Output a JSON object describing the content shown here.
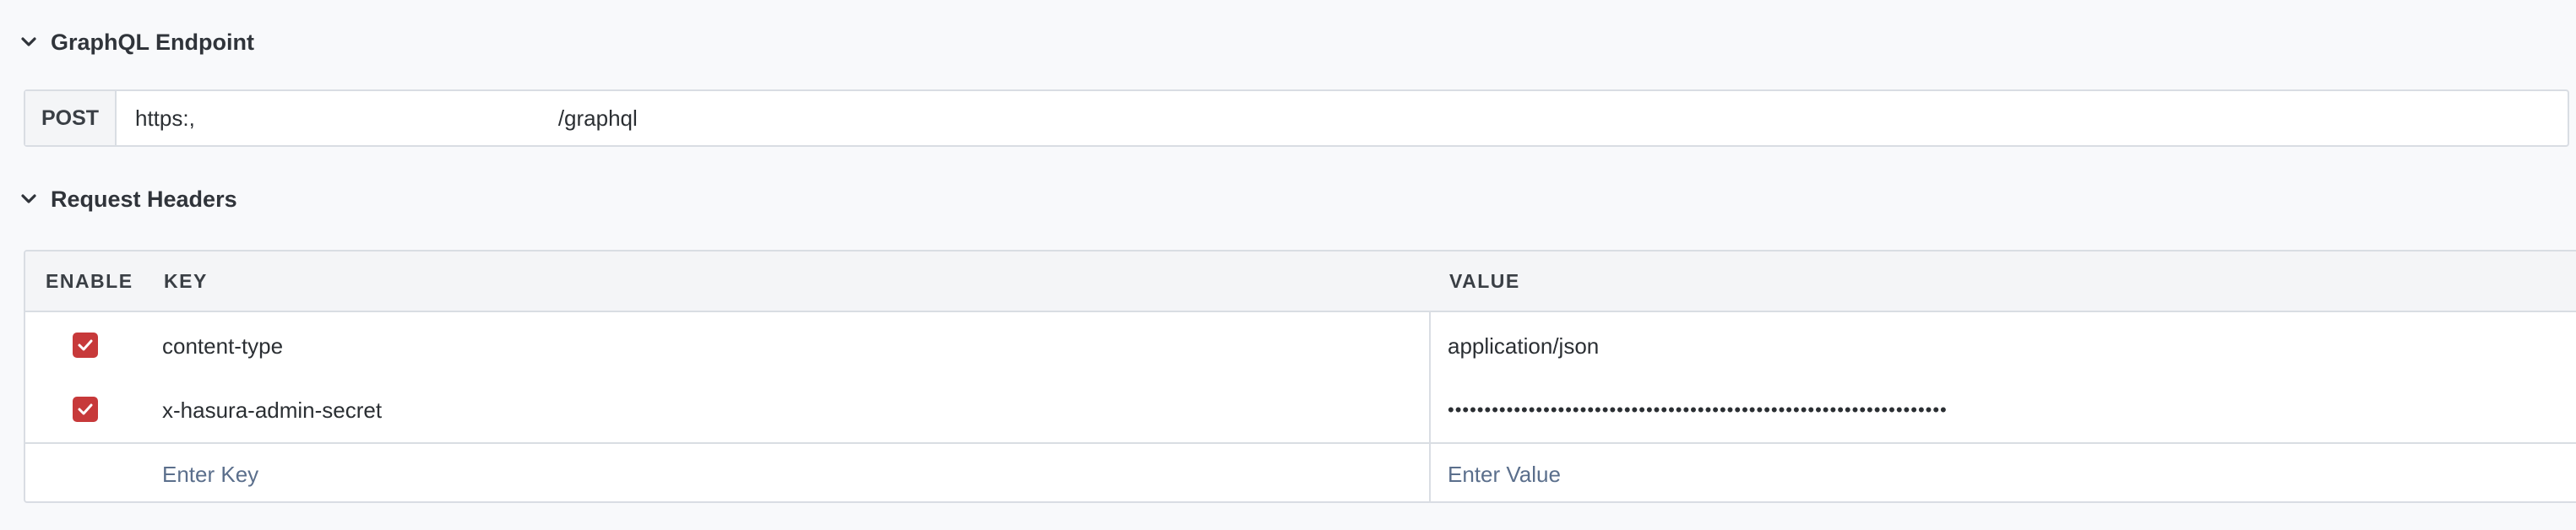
{
  "endpoint_section": {
    "title": "GraphQL Endpoint",
    "method": "POST",
    "url_prefix": "https:,",
    "url_suffix": "/graphql"
  },
  "headers_section": {
    "title": "Request Headers",
    "columns": {
      "enable": "ENABLE",
      "key": "KEY",
      "value": "VALUE"
    },
    "rows": [
      {
        "enabled": true,
        "key": "content-type",
        "value": "application/json"
      },
      {
        "enabled": true,
        "key": "x-hasura-admin-secret",
        "value": "••••••••••••••••••••••••••••••••••••••••••••••••••••••••••••••••••••"
      }
    ],
    "new_row": {
      "key_placeholder": "Enter Key",
      "value_placeholder": "Enter Value"
    }
  },
  "colors": {
    "checkbox": "#c7393a",
    "placeholder": "#5b6f8c",
    "border": "#d9dde3"
  },
  "icons": {
    "collapse": "chevron-down-icon",
    "checked": "check-icon"
  }
}
